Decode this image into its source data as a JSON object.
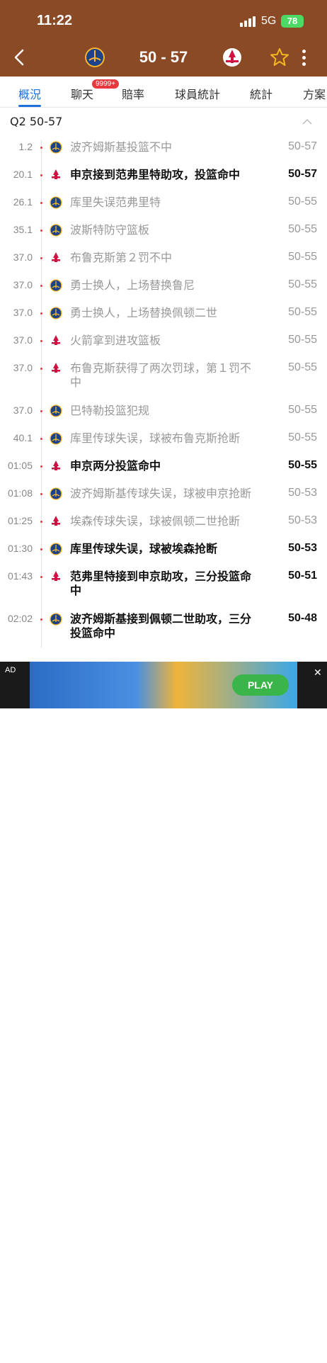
{
  "status_bar": {
    "time": "11:22",
    "network": "5G",
    "battery": "78"
  },
  "header": {
    "score": "50 - 57"
  },
  "tabs": [
    {
      "label": "概況"
    },
    {
      "label": "聊天"
    },
    {
      "label": "賠率"
    },
    {
      "label": "球員統計"
    },
    {
      "label": "統計"
    },
    {
      "label": "方案"
    }
  ],
  "chat_badge": "9999+",
  "quarter_header": "Q2  50-57",
  "events": [
    {
      "time": "1.2",
      "team": "warriors",
      "text": "波齐姆斯基投篮不中",
      "score": "50-57",
      "bold": false
    },
    {
      "time": "20.1",
      "team": "rockets",
      "text": "申京接到范弗里特助攻，投篮命中",
      "score": "50-57",
      "bold": true
    },
    {
      "time": "26.1",
      "team": "warriors",
      "text": "库里失误范弗里特",
      "score": "50-55",
      "bold": false
    },
    {
      "time": "35.1",
      "team": "warriors",
      "text": "波斯特防守篮板",
      "score": "50-55",
      "bold": false
    },
    {
      "time": "37.0",
      "team": "rockets",
      "text": "布鲁克斯第２罚不中",
      "score": "50-55",
      "bold": false
    },
    {
      "time": "37.0",
      "team": "warriors",
      "text": "勇士换人，上场替换鲁尼",
      "score": "50-55",
      "bold": false
    },
    {
      "time": "37.0",
      "team": "warriors",
      "text": "勇士换人，上场替换佩顿二世",
      "score": "50-55",
      "bold": false
    },
    {
      "time": "37.0",
      "team": "rockets",
      "text": "火箭拿到进攻篮板",
      "score": "50-55",
      "bold": false
    },
    {
      "time": "37.0",
      "team": "rockets",
      "text": "布鲁克斯获得了两次罚球，第１罚不中",
      "score": "50-55",
      "bold": false
    },
    {
      "time": "37.0",
      "team": "warriors",
      "text": "巴特勒投篮犯规",
      "score": "50-55",
      "bold": false
    },
    {
      "time": "40.1",
      "team": "warriors",
      "text": "库里传球失误，球被布鲁克斯抢断",
      "score": "50-55",
      "bold": false
    },
    {
      "time": "01:05",
      "team": "rockets",
      "text": "申京两分投篮命中",
      "score": "50-55",
      "bold": true
    },
    {
      "time": "01:08",
      "team": "warriors",
      "text": "波齐姆斯基传球失误，球被申京抢断",
      "score": "50-53",
      "bold": false
    },
    {
      "time": "01:25",
      "team": "rockets",
      "text": "埃森传球失误，球被佩顿二世抢断",
      "score": "50-53",
      "bold": false
    },
    {
      "time": "01:30",
      "team": "warriors",
      "text": "库里传球失误，球被埃森抢断",
      "score": "50-53",
      "bold": true
    },
    {
      "time": "01:43",
      "team": "rockets",
      "text": "范弗里特接到申京助攻，三分投篮命中",
      "score": "50-51",
      "bold": true
    },
    {
      "time": "02:02",
      "team": "warriors",
      "text": "波齐姆斯基接到佩顿二世助攻，三分投篮命中",
      "score": "50-48",
      "bold": true
    }
  ],
  "ad": {
    "label": "AD",
    "play_label": "PLAY"
  },
  "colors": {
    "header_bg": "#8B4A26",
    "accent_blue": "#1E6FD9",
    "dot_red": "#E8383D",
    "battery_green": "#4CD964"
  }
}
